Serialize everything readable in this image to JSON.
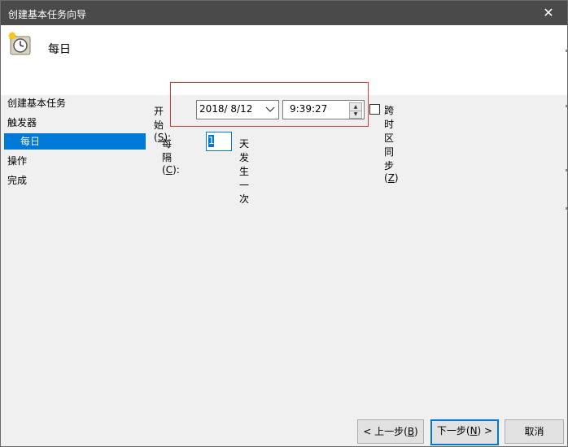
{
  "window": {
    "title": "创建基本任务向导",
    "close_glyph": "✕"
  },
  "header": {
    "title": "每日",
    "icon": "clock-task-icon"
  },
  "nav": {
    "items": [
      {
        "label": "创建基本任务"
      },
      {
        "label": "触发器"
      },
      {
        "label": "每日",
        "selected": true
      },
      {
        "label": "操作"
      },
      {
        "label": "完成"
      }
    ]
  },
  "start": {
    "label_prefix": "开始(",
    "accel": "S",
    "label_suffix": "):",
    "date": "2018/  8/12",
    "time": "9:39:27"
  },
  "sync": {
    "label_prefix": "跨时区同步(",
    "accel": "Z",
    "label_suffix": ")",
    "checked": false
  },
  "recur": {
    "label_prefix": "每隔(",
    "accel": "C",
    "label_suffix": "):",
    "value": "1",
    "unit_text": "天发生一次"
  },
  "buttons": {
    "back": {
      "prefix": "< 上一步(",
      "accel": "B",
      "suffix": ")"
    },
    "next": {
      "prefix": "下一步(",
      "accel": "N",
      "suffix": ") >"
    },
    "cancel": "取消"
  },
  "colors": {
    "titlebar": "#4a4a4a",
    "selection": "#0078d7",
    "highlight_box": "#e03a3a"
  }
}
